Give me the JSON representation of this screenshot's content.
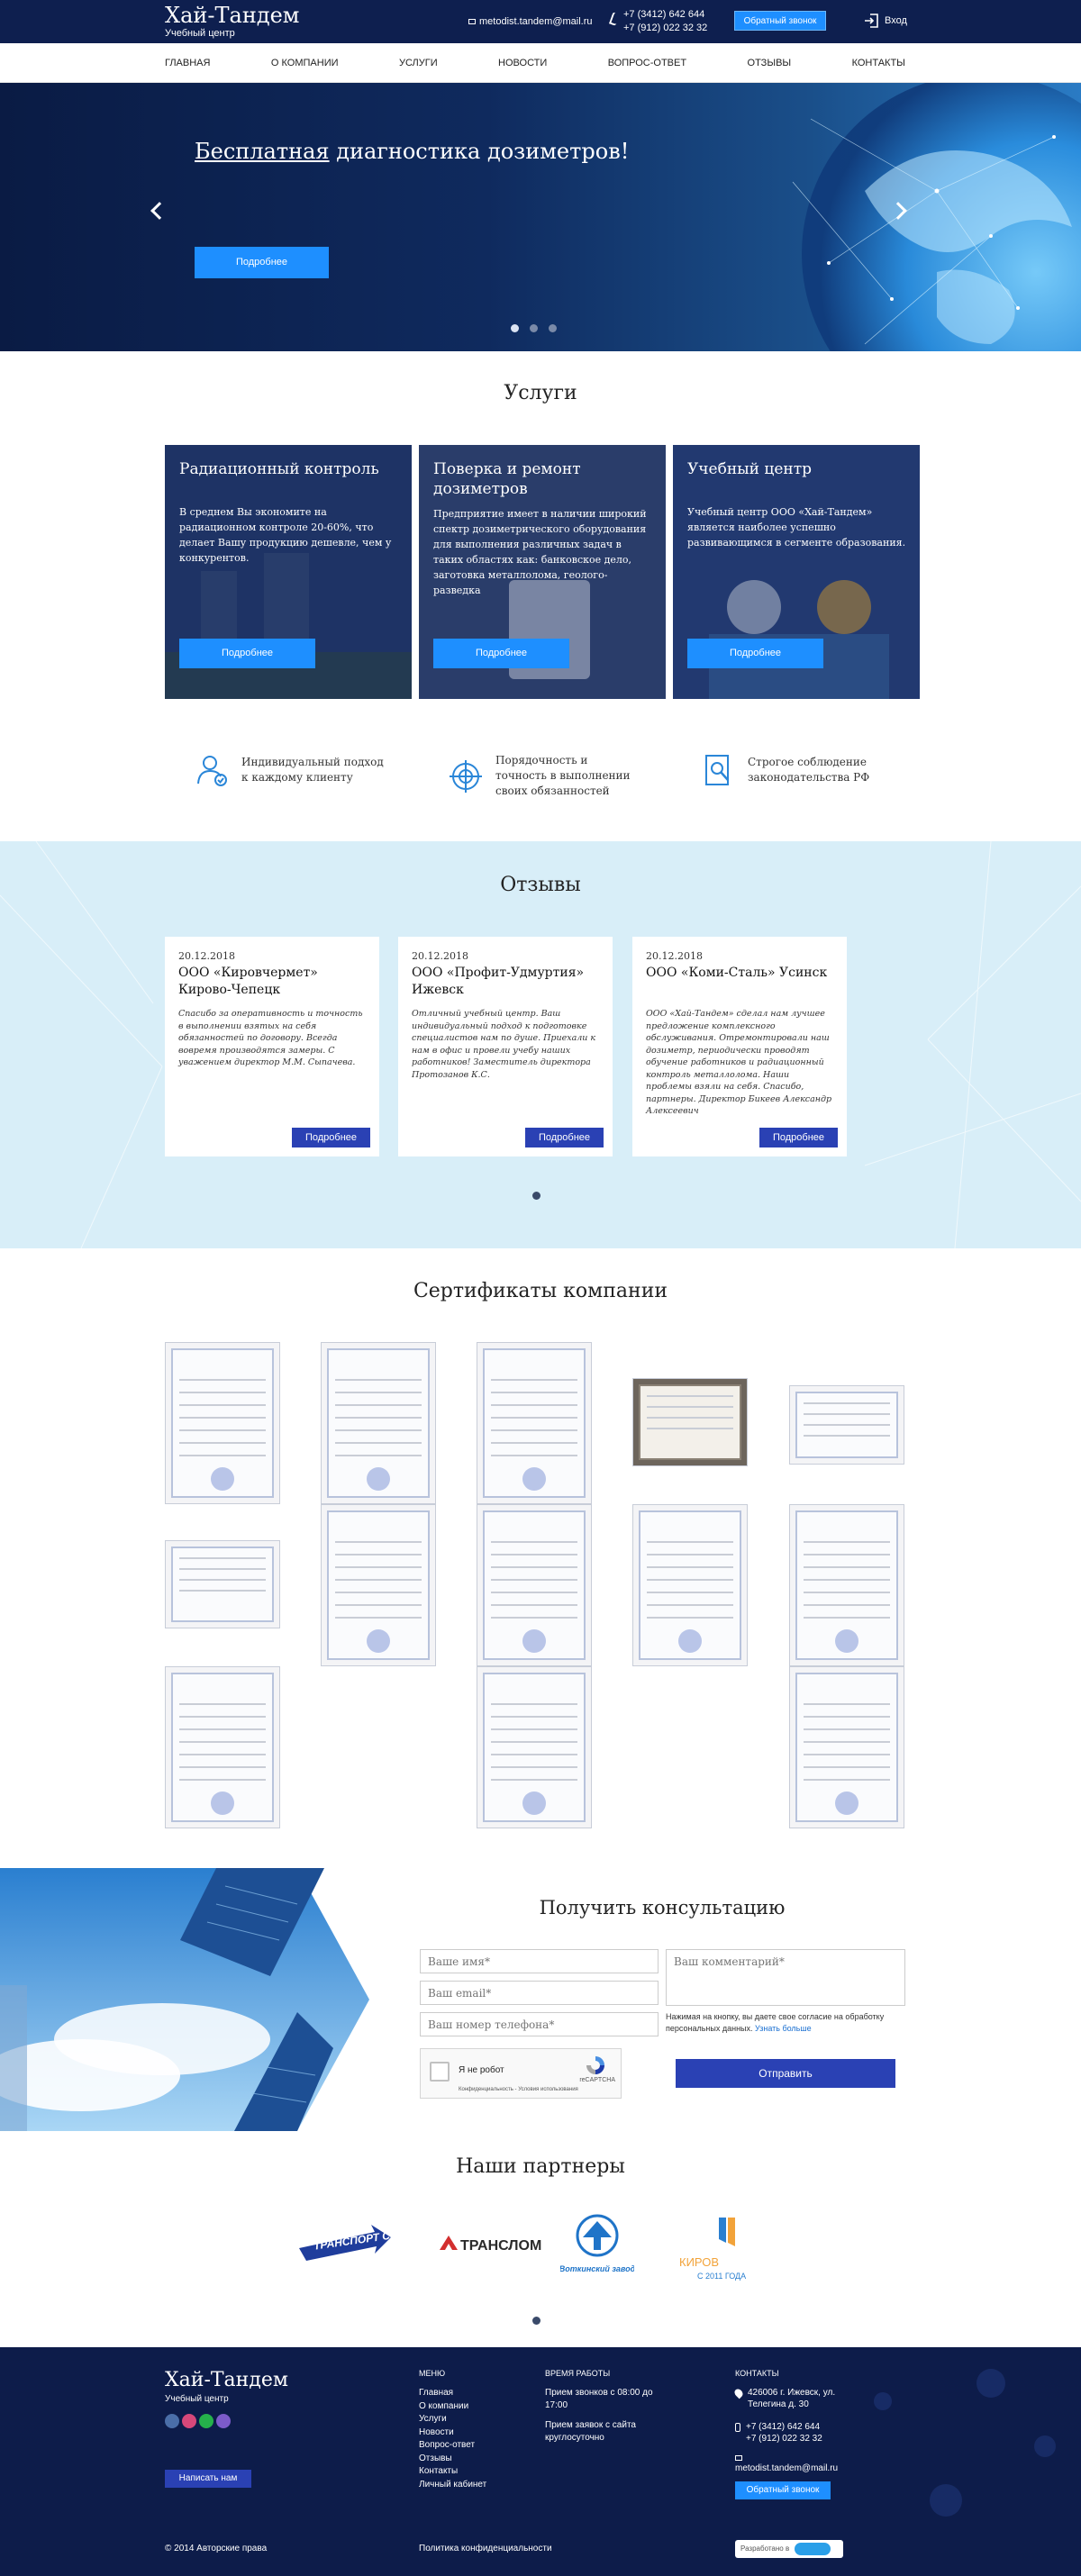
{
  "header": {
    "brand": "Хай-Тандем",
    "tagline": "Учебный центр",
    "email": "metodist.tandem@mail.ru",
    "phone1": "+7 (3412) 642 644",
    "phone2": "+7 (912) 022 32 32",
    "callback": "Обратный звонок",
    "login": "Вход"
  },
  "nav": [
    "ГЛАВНАЯ",
    "О КОМПАНИИ",
    "УСЛУГИ",
    "НОВОСТИ",
    "ВОПРОС-ОТВЕТ",
    "ОТЗЫВЫ",
    "КОНТАКТЫ"
  ],
  "hero": {
    "title_em": "Бесплатная",
    "title_rest": " диагностика дозиметров!",
    "button": "Подробнее"
  },
  "services": {
    "title": "Услуги",
    "cards": [
      {
        "title": "Радиационный контроль",
        "text": "В среднем Вы экономите на радиационном контроле 20-60%, что делает Вашу продукцию дешевле, чем у конкурентов.",
        "button": "Подробнее"
      },
      {
        "title": "Поверка и ремонт дозиметров",
        "text": "Предприятие имеет в наличии широкий спектр дозиметрического оборудования для выполнения различных задач в таких областях как: банковское дело, заготовка металлолома, геолого-разведка",
        "button": "Подробнее"
      },
      {
        "title": "Учебный центр",
        "text": "Учебный центр ООО «Хай-Тандем» является наиболее успешно развивающимся в сегменте образования.",
        "button": "Подробнее"
      }
    ]
  },
  "features": [
    {
      "text": "Индивидуальный подход к каждому клиенту"
    },
    {
      "text": "Порядочность и точность в выполнении своих обязанностей"
    },
    {
      "text": "Строгое соблюдение законодательства РФ"
    }
  ],
  "reviews": {
    "title": "Отзывы",
    "items": [
      {
        "date": "20.12.2018",
        "company": "ООО «Кировчермет» Кирово-Чепецк",
        "text": "Спасибо за оперативность и точность в выполнении взятых на себя обязанностей по договору. Всегда вовремя производятся замеры. С уважением директор М.М. Сыпачева.",
        "button": "Подробнее"
      },
      {
        "date": "20.12.2018",
        "company": "ООО «Профит-Удмуртия» Ижевск",
        "text": "Отличный учебный центр. Ваш индивидуальный подход к подготовке специалистов нам по душе. Приехали к нам в офис и провели учебу наших работников! Заместитель директора Протозанов К.С.",
        "button": "Подробнее"
      },
      {
        "date": "20.12.2018",
        "company": "ООО «Коми-Сталь» Усинск",
        "text": "ООО «Хай-Тандем» сделал нам лучшее предложение комплексного обслуживания. Отремонтировали наш дозиметр, периодически проводят обучение работников и радиационный контроль металлолома. Наши проблемы взяли на себя. Спасибо, партнеры. Директор Бикеев Александр Алексеевич",
        "button": "Подробнее"
      }
    ]
  },
  "certificates": {
    "title": "Сертификаты компании"
  },
  "consult": {
    "title": "Получить консультацию",
    "name_ph": "Ваше имя*",
    "email_ph": "Ваш email*",
    "phone_ph": "Ваш номер телефона*",
    "comment_ph": "Ваш комментарий*",
    "consent": "Нажимая на кнопку, вы даете свое согласие на обработку персональных данных.",
    "consent_link": "Узнать больше",
    "captcha_label": "Я не робот",
    "captcha_brand": "reCAPTCHA",
    "captcha_terms": "Конфиденциальность - Условия использования",
    "send": "Отправить"
  },
  "partners": {
    "title": "Наши партнеры",
    "logos": [
      "ТРАНСПОРТ СИБИРИ",
      "ТРАНСЛОМ",
      "Воткинский завод",
      "КИРОВ",
      "С 2011 ГОДА"
    ]
  },
  "footer": {
    "brand": "Хай-Тандем",
    "tagline": "Учебный центр",
    "write_us": "Написать нам",
    "copyright": "© 2014 Авторские права",
    "menu_title": "МЕНЮ",
    "menu": [
      "Главная",
      "О компании",
      "Услуги",
      "Новости",
      "Вопрос-ответ",
      "Отзывы",
      "Контакты",
      "Личный кабинет"
    ],
    "hours_title": "ВРЕМЯ РАБОТЫ",
    "hours1": "Прием звонков с 08:00 до 17:00",
    "hours2": "Прием заявок с сайта круглосуточно",
    "contacts_title": "КОНТАКТЫ",
    "address": "426006 г. Ижевск, ул. Телегина д. 30",
    "phone1": "+7 (3412) 642 644",
    "phone2": "+7 (912) 022 32 32",
    "email": "metodist.tandem@mail.ru",
    "callback": "Обратный звонок",
    "policy": "Политика конфиденциальности",
    "dev_label": "Разработано в"
  },
  "colors": {
    "navy": "#0e1f4f",
    "accent": "#1e8fff",
    "button_dark": "#2a41b4",
    "reviews_bg": "#d8eef8"
  }
}
